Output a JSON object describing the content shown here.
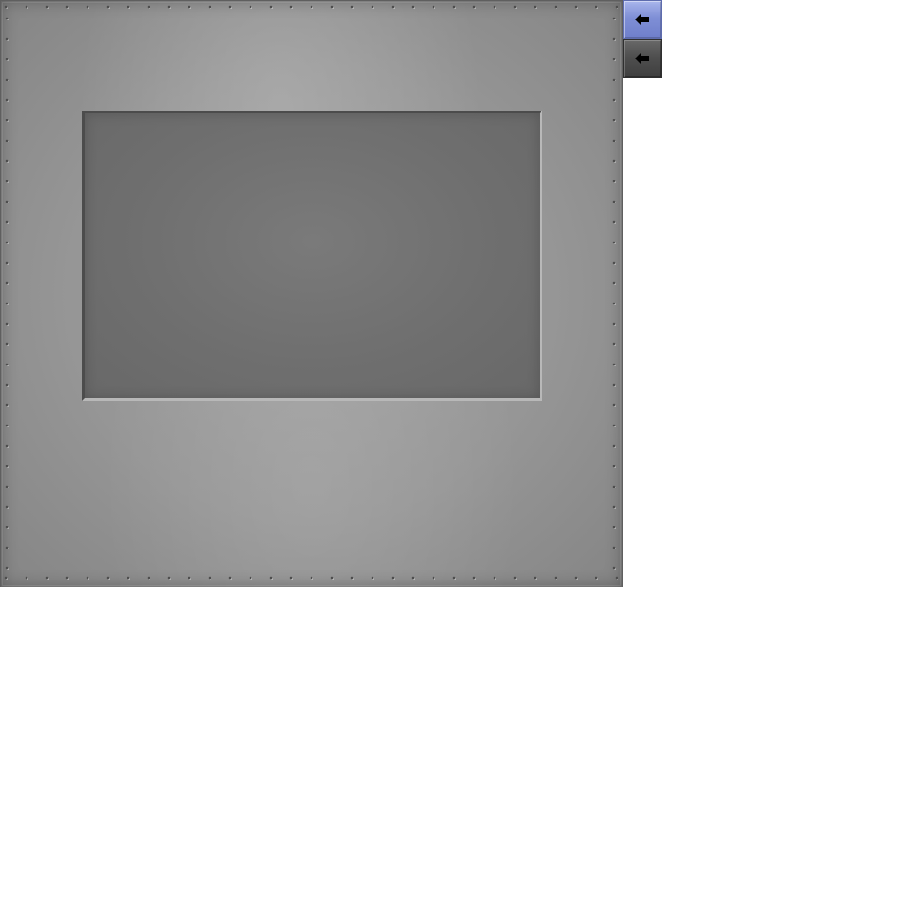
{
  "ui": {
    "panel": {
      "name": "metal-panel",
      "inset_name": "inset-display"
    },
    "buttons": [
      {
        "name": "back-button-primary",
        "icon": "left-arrow-icon",
        "state": "active",
        "color": "#7f8fd6"
      },
      {
        "name": "back-button-secondary",
        "icon": "left-arrow-icon",
        "state": "inactive",
        "color": "#4f4f4f"
      }
    ]
  }
}
